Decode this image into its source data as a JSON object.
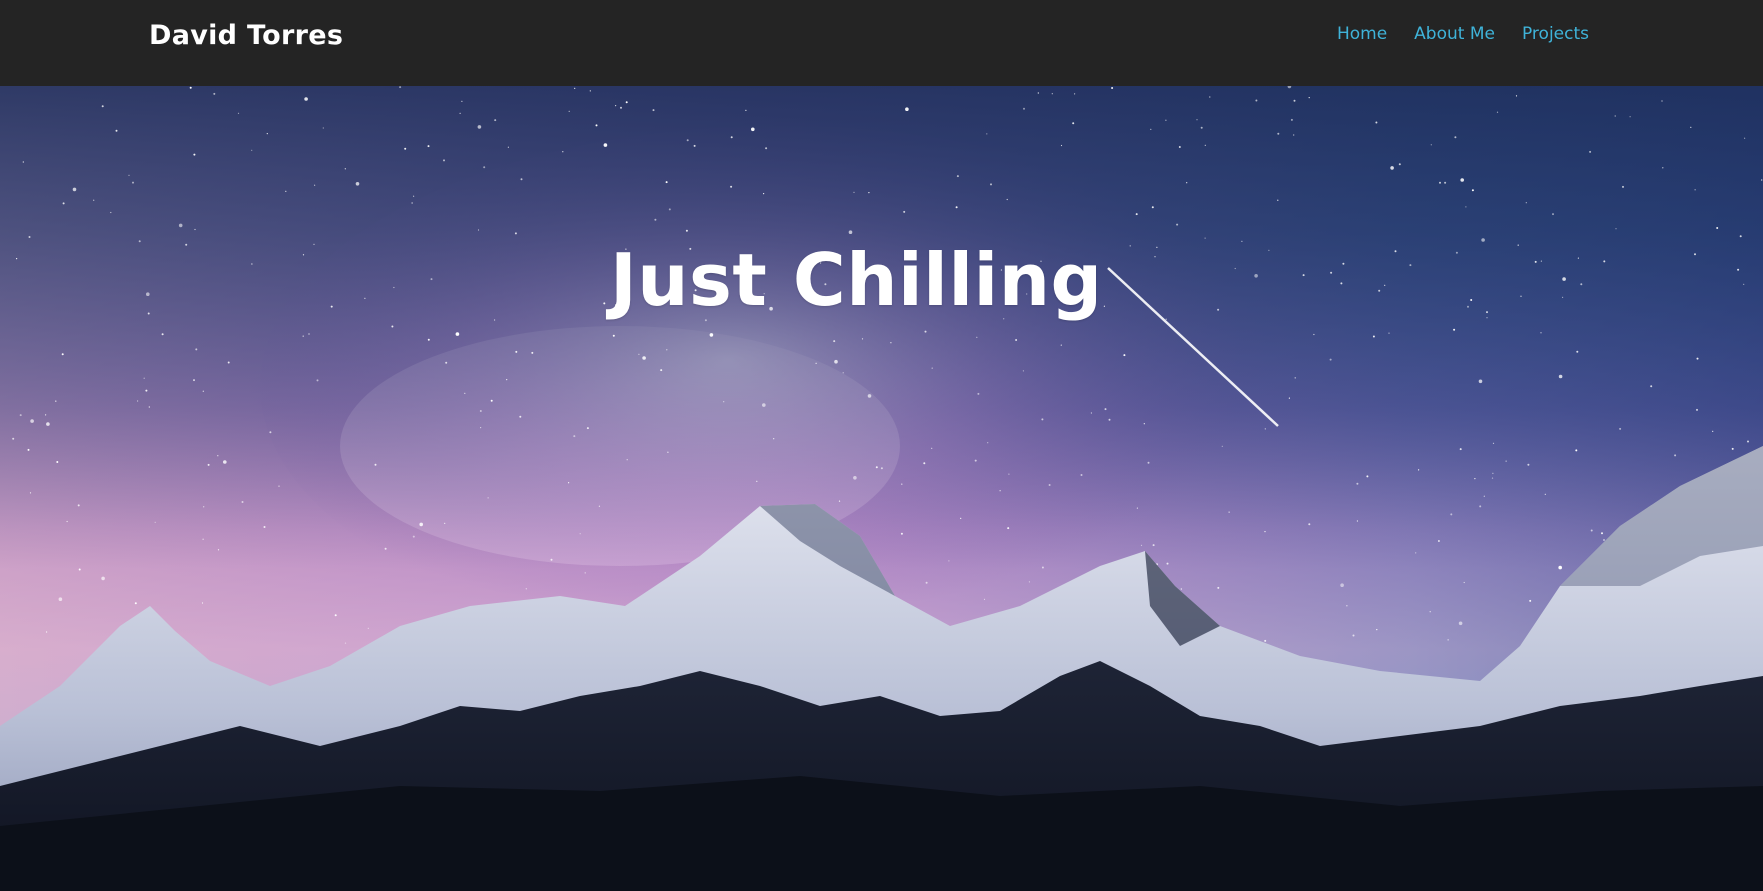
{
  "header": {
    "brand": "David Torres",
    "nav": [
      {
        "label": "Home"
      },
      {
        "label": "About Me"
      },
      {
        "label": "Projects"
      }
    ]
  },
  "hero": {
    "title": "Just Chilling",
    "background": "night-sky-mountains-image"
  },
  "colors": {
    "navbar_bg": "#242424",
    "nav_link": "#3fb3d9",
    "brand_text": "#ffffff",
    "hero_title": "#ffffff"
  }
}
